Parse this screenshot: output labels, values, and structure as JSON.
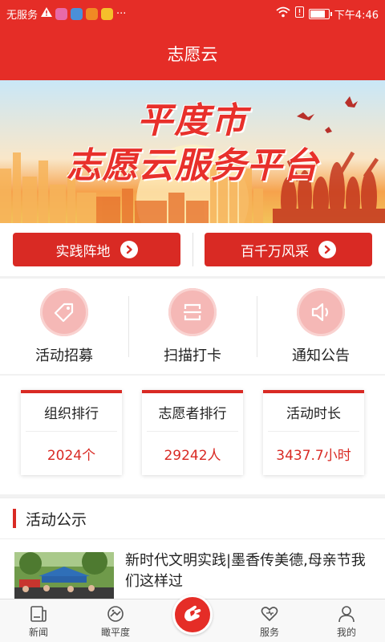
{
  "status_bar": {
    "carrier": "无服务",
    "time": "下午4:46",
    "battery_level": 0.85,
    "more_indicator": "···"
  },
  "header": {
    "title": "志愿云"
  },
  "banner": {
    "line1": "平度市",
    "line2": "志愿云服务平台"
  },
  "quick_links": [
    {
      "label": "实践阵地"
    },
    {
      "label": "百千万风采"
    }
  ],
  "functions": [
    {
      "label": "活动招募",
      "icon": "tag-icon"
    },
    {
      "label": "扫描打卡",
      "icon": "scan-icon"
    },
    {
      "label": "通知公告",
      "icon": "speaker-icon"
    }
  ],
  "stats": [
    {
      "title": "组织排行",
      "value": "2024个"
    },
    {
      "title": "志愿者排行",
      "value": "29242人"
    },
    {
      "title": "活动时长",
      "value": "3437.7小时"
    }
  ],
  "section": {
    "title": "活动公示"
  },
  "news": [
    {
      "title": "新时代文明实践|墨香传美德,母亲节我们这样过"
    }
  ],
  "tabs": [
    {
      "label": "新闻",
      "icon": "news-icon"
    },
    {
      "label": "瞰平度",
      "icon": "compass-icon"
    },
    {
      "label": "",
      "icon": "volunteer-hand-icon"
    },
    {
      "label": "服务",
      "icon": "heart-icon"
    },
    {
      "label": "我的",
      "icon": "user-icon"
    }
  ],
  "colors": {
    "primary_red": "#e52d27",
    "button_red": "#d92a24",
    "icon_pink": "#f5b8b6"
  }
}
